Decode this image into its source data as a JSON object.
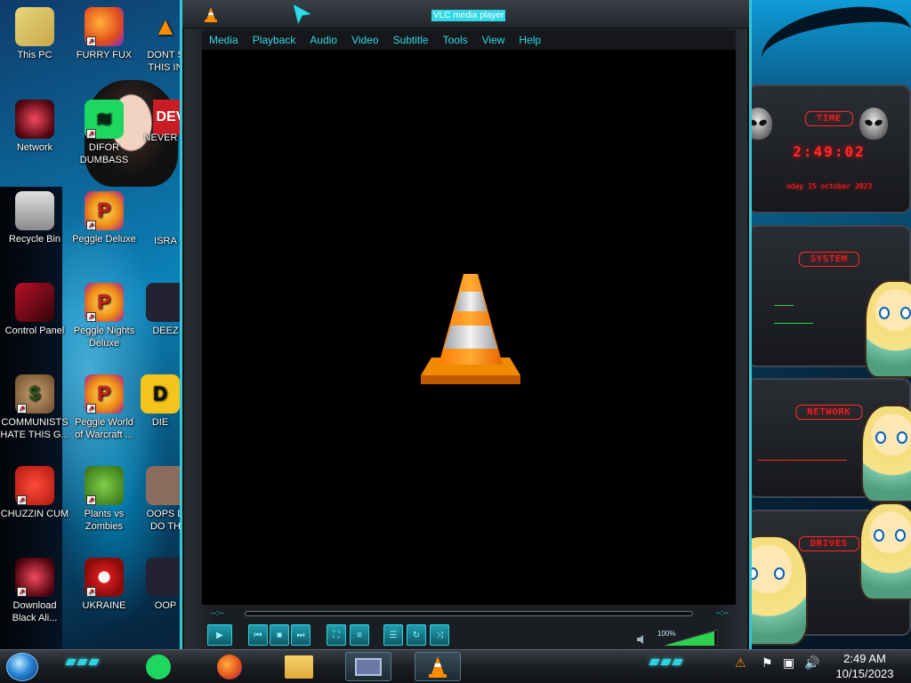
{
  "desktop": {
    "icons": [
      {
        "label": "This PC"
      },
      {
        "label": "FURRY FUX"
      },
      {
        "label": "DONT S THIS IN"
      },
      {
        "label": "Network"
      },
      {
        "label": "DIFOR DUMBASS"
      },
      {
        "label": "NEVER U"
      },
      {
        "label": "Recycle Bin"
      },
      {
        "label": "Peggle Deluxe"
      },
      {
        "label": "ISRA"
      },
      {
        "label": "Control Panel"
      },
      {
        "label": "Peggle Nights Deluxe"
      },
      {
        "label": "DEEZ"
      },
      {
        "label": "COMMUNISTS HATE THIS G..."
      },
      {
        "label": "Peggle World of Warcraft ..."
      },
      {
        "label": "DIE"
      },
      {
        "label": "CHUZZIN CUM"
      },
      {
        "label": "Plants vs Zombies"
      },
      {
        "label": "OOPS D DO TH"
      },
      {
        "label": "Download Black Ali..."
      },
      {
        "label": "UKRAINE"
      },
      {
        "label": "OOP"
      }
    ],
    "wallpaper_text": "DEV"
  },
  "vlc": {
    "title": "VLC media player",
    "menu": [
      "Media",
      "Playback",
      "Audio",
      "Video",
      "Subtitle",
      "Tools",
      "View",
      "Help"
    ],
    "time_elapsed": "--:--",
    "time_total": "--:--",
    "volume": "100%",
    "accent": "#31d8e6"
  },
  "rainmeter": {
    "time_header": "TIME",
    "time": "2:49:02",
    "date": "nday 15 october 2023",
    "system_header": "SYSTEM",
    "network_header": "NETWORK",
    "drives_header": "DRIVES",
    "accent": "#ff2a2a"
  },
  "taskbar": {
    "clock_time": "2:49 AM",
    "clock_date": "10/15/2023",
    "apps": [
      "spotify-icon",
      "firefox-icon",
      "file-explorer-icon",
      "window-icon",
      "vlc-icon"
    ]
  }
}
